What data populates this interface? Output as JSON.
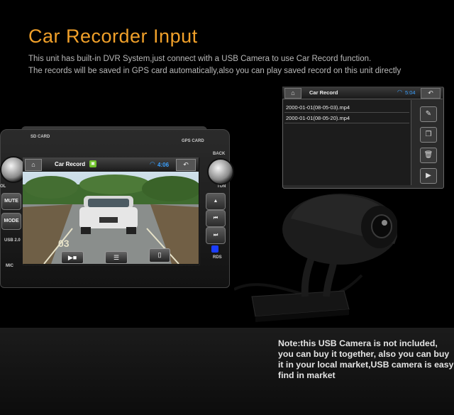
{
  "header": {
    "title": "Car Recorder Input",
    "line1": "This unit has built-in DVR System,just connect with a USB Camera to use Car Record function.",
    "line2": "The records will be saved in GPS card automatically,also you can play saved record on this unit directly"
  },
  "zoom_panel": {
    "title": "Car Record",
    "time": "5:04",
    "files": [
      "2000-01-01(08-05-03).mp4",
      "2000-01-01(08-05-20).mp4"
    ]
  },
  "unit": {
    "labels": {
      "sd": "SD CARD",
      "gps": "GPS CARD",
      "back": "BACK",
      "vol": "OL",
      "tun": "TUN",
      "usb": "USB 2.0",
      "mic": "MIC",
      "rds": "RDS"
    },
    "buttons": {
      "mute": "MUTE",
      "mode": "MODE"
    },
    "screen": {
      "title": "Car Record",
      "time": "4:06"
    }
  },
  "note": {
    "line1": "Note:this USB Camera is not included,",
    "line2": "you can buy it together, also you can buy",
    "line3": "it in your local market,USB camera is easy",
    "line4": "find in market"
  },
  "colors": {
    "title": "#f0a02a",
    "status_blue": "#3aa0ff"
  }
}
